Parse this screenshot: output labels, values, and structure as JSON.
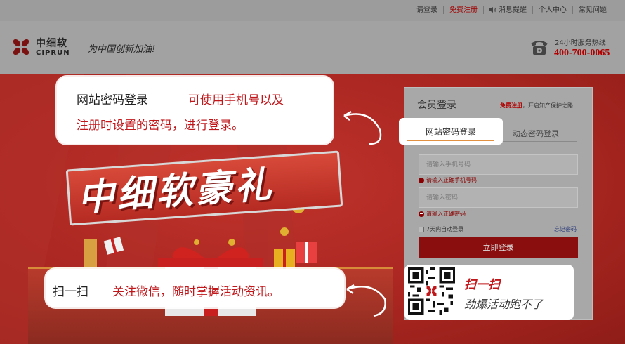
{
  "topnav": {
    "login": "请登录",
    "register": "免费注册",
    "notifications": "消息提醒",
    "personal_center": "个人中心",
    "faq": "常见问题"
  },
  "header": {
    "brand_cn": "中细软",
    "brand_en": "CIPRUN",
    "slogan": "为中国创新加油!",
    "hotline_label": "24小时服务热线",
    "hotline_number": "400-700-0065"
  },
  "banner": {
    "promo_text": "中细软豪礼"
  },
  "tooltips": {
    "login_title": "网站密码登录",
    "login_desc": "可使用手机号以及",
    "login_desc2": "注册时设置的密码，进行登录。",
    "scan_label": "扫一扫",
    "scan_desc": "关注微信，随时掌握活动资讯。"
  },
  "login": {
    "title": "会员登录",
    "register_link": "免费注册",
    "register_suffix": "，开启知产保护之路",
    "tab_password": "网站密码登录",
    "tab_dynamic": "动态密码登录",
    "phone_placeholder": "请输入手机号码",
    "phone_error": "请输入正确手机号码",
    "password_placeholder": "请输入密码",
    "password_error": "请输入正确密码",
    "remember": "7天内自动登录",
    "forgot": "忘记密码",
    "submit": "立即登录"
  },
  "qr": {
    "title": "扫一扫",
    "subtitle": "劲爆活动跑不了"
  },
  "colors": {
    "brand_red": "#c0171b",
    "dark_red_button": "#8a0e0e",
    "banner_red": "#a82520"
  }
}
